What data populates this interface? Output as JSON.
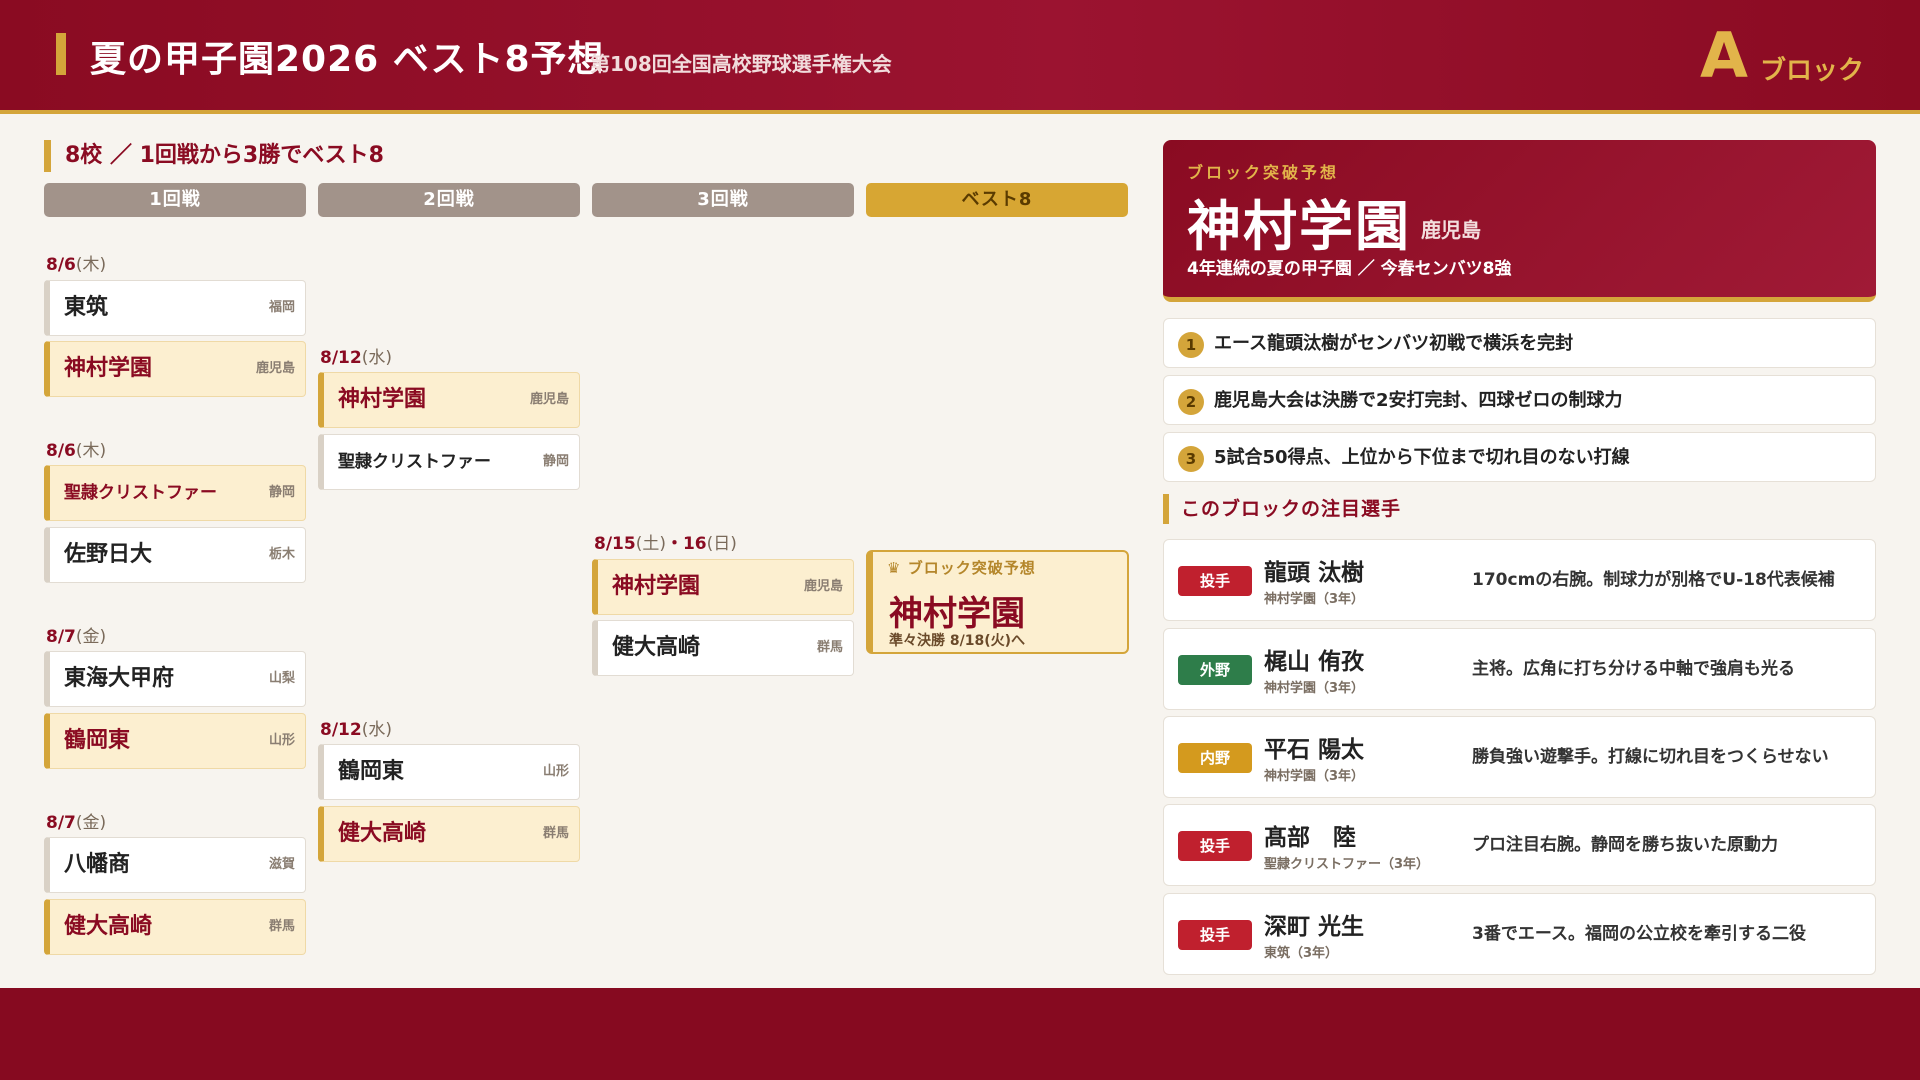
{
  "header": {
    "title": "夏の甲子園2026 ベスト8予想",
    "subtitle": "第108回全国高校野球選手権大会",
    "block_letter": "A",
    "block_word": "ブロック"
  },
  "bracket": {
    "section_title": "8校 ／ 1回戦から3勝でベスト8",
    "rounds": [
      "1回戦",
      "2回戦",
      "3回戦",
      "ベスト8"
    ],
    "r1": [
      {
        "date": "8/6",
        "dow": "(木)",
        "teams": [
          {
            "name": "東筑",
            "pref": "福岡",
            "win": false
          },
          {
            "name": "神村学園",
            "pref": "鹿児島",
            "win": true
          }
        ]
      },
      {
        "date": "8/6",
        "dow": "(木)",
        "teams": [
          {
            "name": "聖隷クリストファー",
            "pref": "静岡",
            "win": true
          },
          {
            "name": "佐野日大",
            "pref": "栃木",
            "win": false
          }
        ]
      },
      {
        "date": "8/7",
        "dow": "(金)",
        "teams": [
          {
            "name": "東海大甲府",
            "pref": "山梨",
            "win": false
          },
          {
            "name": "鶴岡東",
            "pref": "山形",
            "win": true
          }
        ]
      },
      {
        "date": "8/7",
        "dow": "(金)",
        "teams": [
          {
            "name": "八幡商",
            "pref": "滋賀",
            "win": false
          },
          {
            "name": "健大高崎",
            "pref": "群馬",
            "win": true
          }
        ]
      }
    ],
    "r2": [
      {
        "date": "8/12",
        "dow": "(水)",
        "teams": [
          {
            "name": "神村学園",
            "pref": "鹿児島",
            "win": true
          },
          {
            "name": "聖隷クリストファー",
            "pref": "静岡",
            "win": false
          }
        ]
      },
      {
        "date": "8/12",
        "dow": "(水)",
        "teams": [
          {
            "name": "鶴岡東",
            "pref": "山形",
            "win": false
          },
          {
            "name": "健大高崎",
            "pref": "群馬",
            "win": true
          }
        ]
      }
    ],
    "r3": {
      "date": "8/15",
      "dow": "(土)",
      "date2": "・16",
      "dow2": "(日)",
      "teams": [
        {
          "name": "神村学園",
          "pref": "鹿児島",
          "win": true
        },
        {
          "name": "健大高崎",
          "pref": "群馬",
          "win": false
        }
      ]
    },
    "best8": {
      "label": "ブロック突破予想",
      "name": "神村学園",
      "next": "準々決勝 8/18(火)へ"
    }
  },
  "prediction": {
    "label": "ブロック突破予想",
    "school": "神村学園",
    "pref": "鹿児島",
    "note": "4年連続の夏の甲子園 ／ 今春センバツ8強"
  },
  "points": [
    {
      "num": "1",
      "text": "エース龍頭汰樹がセンバツ初戦で横浜を完封"
    },
    {
      "num": "2",
      "text": "鹿児島大会は決勝で2安打完封、四球ゼロの制球力"
    },
    {
      "num": "3",
      "text": "5試合50得点、上位から下位まで切れ目のない打線"
    }
  ],
  "players_title": "このブロックの注目選手",
  "players": [
    {
      "pos": "投手",
      "color": "#c0202e",
      "name": "龍頭 汰樹",
      "team": "神村学園（3年）",
      "desc": "170cmの右腕。制球力が別格でU-18代表候補"
    },
    {
      "pos": "外野",
      "color": "#2e7d4a",
      "name": "梶山 侑孜",
      "team": "神村学園（3年）",
      "desc": "主将。広角に打ち分ける中軸で強肩も光る"
    },
    {
      "pos": "内野",
      "color": "#d49a1e",
      "name": "平石 陽太",
      "team": "神村学園（3年）",
      "desc": "勝負強い遊撃手。打線に切れ目をつくらせない"
    },
    {
      "pos": "投手",
      "color": "#c0202e",
      "name": "髙部　陸",
      "team": "聖隷クリストファー（3年）",
      "desc": "プロ注目右腕。静岡を勝ち抜いた原動力"
    },
    {
      "pos": "投手",
      "color": "#c0202e",
      "name": "深町 光生",
      "team": "東筑（3年）",
      "desc": "3番でエース。福岡の公立校を牽引する二役"
    }
  ],
  "colors": {
    "brand": "#8a0b22",
    "gold": "#d4a53a"
  }
}
